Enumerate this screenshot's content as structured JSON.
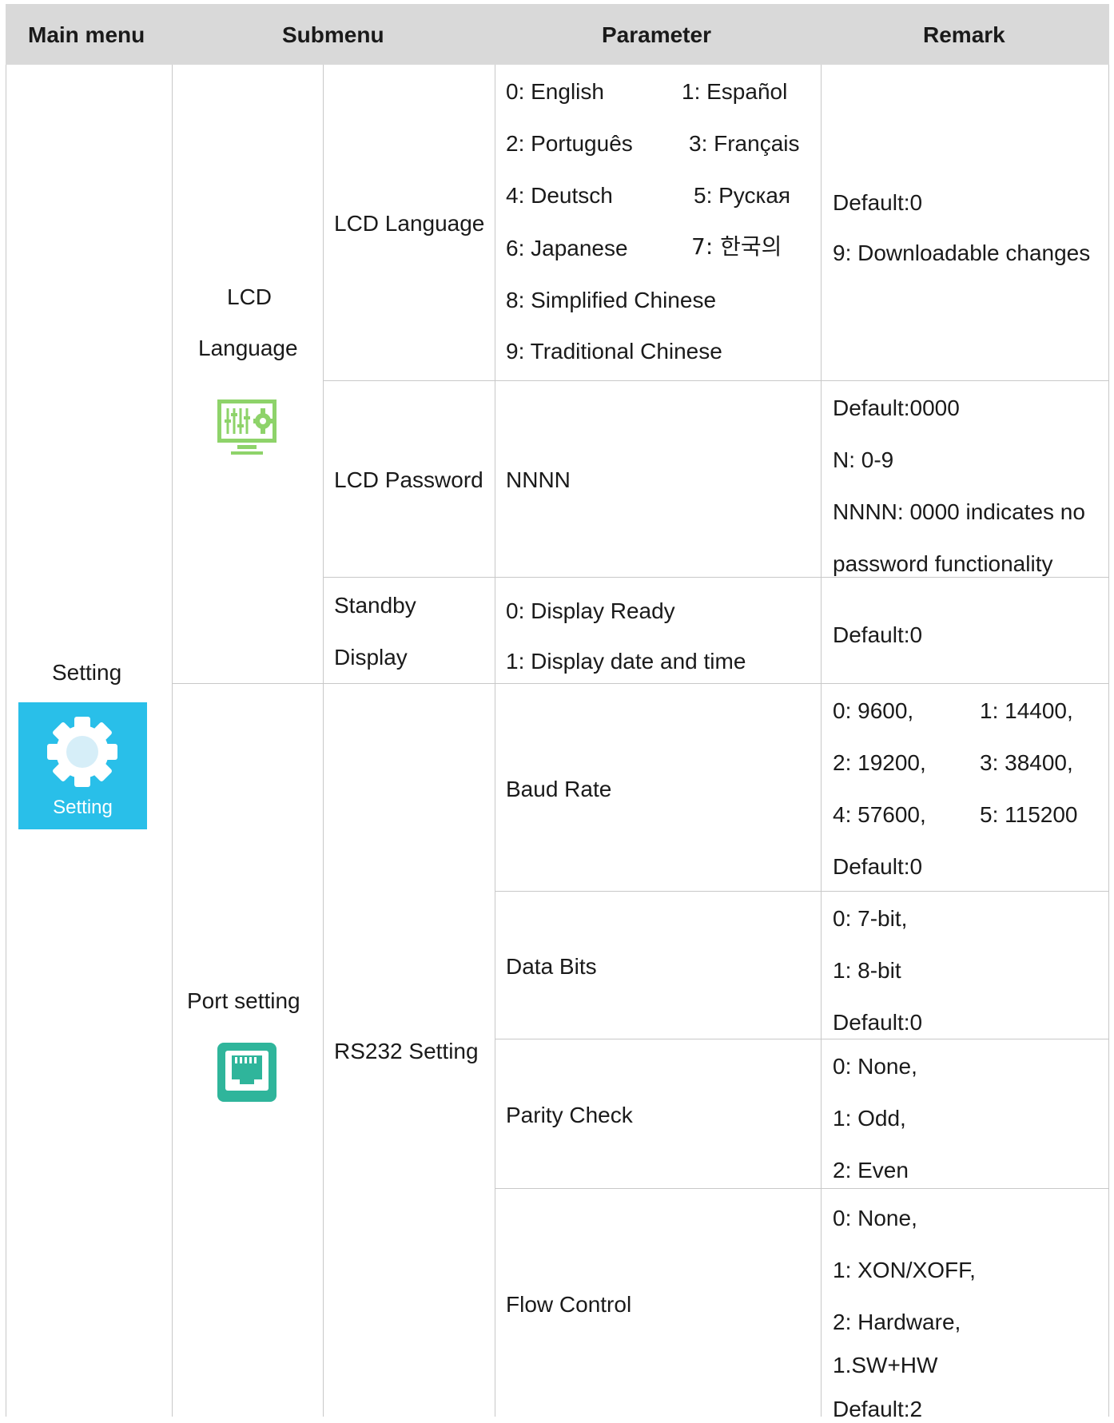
{
  "header": {
    "main_menu": "Main menu",
    "submenu": "Submenu",
    "parameter": "Parameter",
    "remark": "Remark"
  },
  "setting": {
    "label": "Setting",
    "icon_label": "Setting",
    "icon_color": "#29bfe9"
  },
  "lcd": {
    "group_label_1": "LCD",
    "group_label_2": "Language",
    "icon_color": "#8ed36a",
    "language": {
      "name": "LCD Language",
      "options": [
        "0: English",
        "1: Español",
        "2: Português",
        "3: Français",
        "4: Deutsch",
        "5: Руская",
        "6: Japanese",
        "7: 한국의",
        "8: Simplified Chinese",
        "9: Traditional Chinese"
      ],
      "remark_1": "Default:0",
      "remark_2": "9: Downloadable changes"
    },
    "password": {
      "name": "LCD Password",
      "param": "NNNN",
      "remark_1": "Default:0000",
      "remark_2": "N: 0-9",
      "remark_3": "NNNN: 0000 indicates no",
      "remark_4": "password functionality"
    },
    "standby": {
      "name_1": "Standby",
      "name_2": "Display",
      "param_1": "0: Display Ready",
      "param_2": "1: Display date and time",
      "remark": "Default:0"
    }
  },
  "port": {
    "group_label": "Port setting",
    "icon_color": "#2fb59b",
    "submenu": "RS232 Setting",
    "baud": {
      "name": "Baud Rate",
      "values": [
        "0: 9600,",
        "1: 14400,",
        "2: 19200,",
        "3: 38400,",
        "4: 57600,",
        "5: 115200"
      ],
      "default": "Default:0"
    },
    "data_bits": {
      "name": "Data Bits",
      "remarks": [
        "0: 7-bit,",
        "1: 8-bit",
        "Default:0"
      ]
    },
    "parity": {
      "name": "Parity Check",
      "remarks": [
        "0: None,",
        "1: Odd,",
        "2: Even"
      ]
    },
    "flow": {
      "name": "Flow Control",
      "remarks": [
        "0: None,",
        "1: XON/XOFF,",
        "2: Hardware,",
        "1.SW+HW",
        "Default:2"
      ]
    }
  }
}
